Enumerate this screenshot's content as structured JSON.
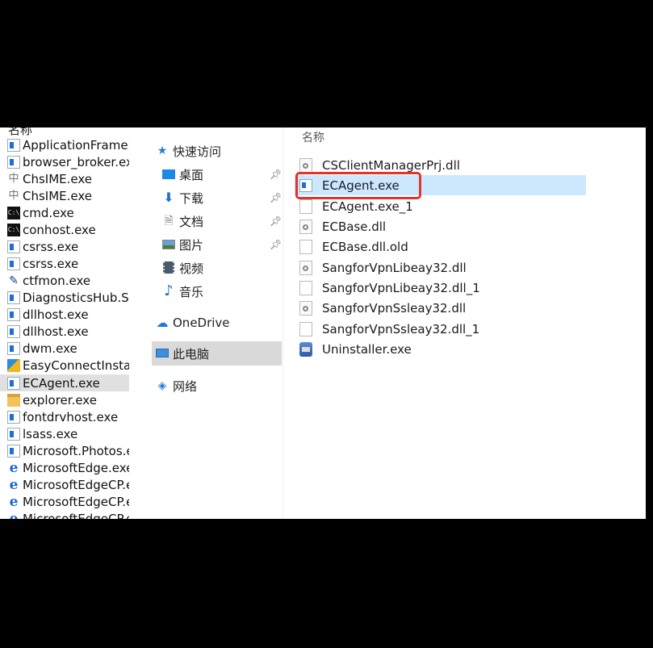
{
  "process_list": {
    "header": "名称",
    "items": [
      {
        "name": "ApplicationFrameH",
        "icon": "app-window-icon"
      },
      {
        "name": "browser_broker.exe",
        "icon": "app-window-icon"
      },
      {
        "name": "ChsIME.exe",
        "icon": "ime-icon"
      },
      {
        "name": "ChsIME.exe",
        "icon": "ime-icon"
      },
      {
        "name": "cmd.exe",
        "icon": "console-icon"
      },
      {
        "name": "conhost.exe",
        "icon": "console-icon"
      },
      {
        "name": "csrss.exe",
        "icon": "app-window-icon"
      },
      {
        "name": "csrss.exe",
        "icon": "app-window-icon"
      },
      {
        "name": "ctfmon.exe",
        "icon": "pen-icon"
      },
      {
        "name": "DiagnosticsHub.Sta",
        "icon": "app-window-icon"
      },
      {
        "name": "dllhost.exe",
        "icon": "app-window-icon"
      },
      {
        "name": "dllhost.exe",
        "icon": "app-window-icon"
      },
      {
        "name": "dwm.exe",
        "icon": "app-window-icon"
      },
      {
        "name": "EasyConnectInstalle",
        "icon": "easyconnect-icon"
      },
      {
        "name": "ECAgent.exe",
        "icon": "app-window-icon",
        "selected": true
      },
      {
        "name": "explorer.exe",
        "icon": "folder-icon"
      },
      {
        "name": "fontdrvhost.exe",
        "icon": "app-window-icon"
      },
      {
        "name": "lsass.exe",
        "icon": "app-window-icon"
      },
      {
        "name": "Microsoft.Photos.ex",
        "icon": "app-window-icon"
      },
      {
        "name": "MicrosoftEdge.exe",
        "icon": "edge-icon"
      },
      {
        "name": "MicrosoftEdgeCP.e",
        "icon": "edge-icon"
      },
      {
        "name": "MicrosoftEdgeCP.e",
        "icon": "edge-icon"
      },
      {
        "name": "MicrosoftEdgeCP.e",
        "icon": "edge-icon"
      }
    ]
  },
  "nav": {
    "quick_access": "快速访问",
    "desktop": "桌面",
    "downloads": "下载",
    "documents": "文档",
    "pictures": "图片",
    "videos": "视频",
    "music": "音乐",
    "onedrive": "OneDrive",
    "this_pc": "此电脑",
    "network": "网络"
  },
  "files": {
    "header": "名称",
    "items": [
      {
        "name": "CSClientManagerPrj.dll",
        "icon": "dll-icon"
      },
      {
        "name": "ECAgent.exe",
        "icon": "exe-icon",
        "selected": true
      },
      {
        "name": "ECAgent.exe_1",
        "icon": "blank-file-icon"
      },
      {
        "name": "ECBase.dll",
        "icon": "dll-icon"
      },
      {
        "name": "ECBase.dll.old",
        "icon": "blank-file-icon"
      },
      {
        "name": "SangforVpnLibeay32.dll",
        "icon": "dll-icon"
      },
      {
        "name": "SangforVpnLibeay32.dll_1",
        "icon": "blank-file-icon"
      },
      {
        "name": "SangforVpnSsleay32.dll",
        "icon": "dll-icon"
      },
      {
        "name": "SangforVpnSsleay32.dll_1",
        "icon": "blank-file-icon"
      },
      {
        "name": "Uninstaller.exe",
        "icon": "uninstaller-icon"
      }
    ]
  },
  "colors": {
    "highlight_border": "#e0352b",
    "selection": "#cce8ff"
  }
}
